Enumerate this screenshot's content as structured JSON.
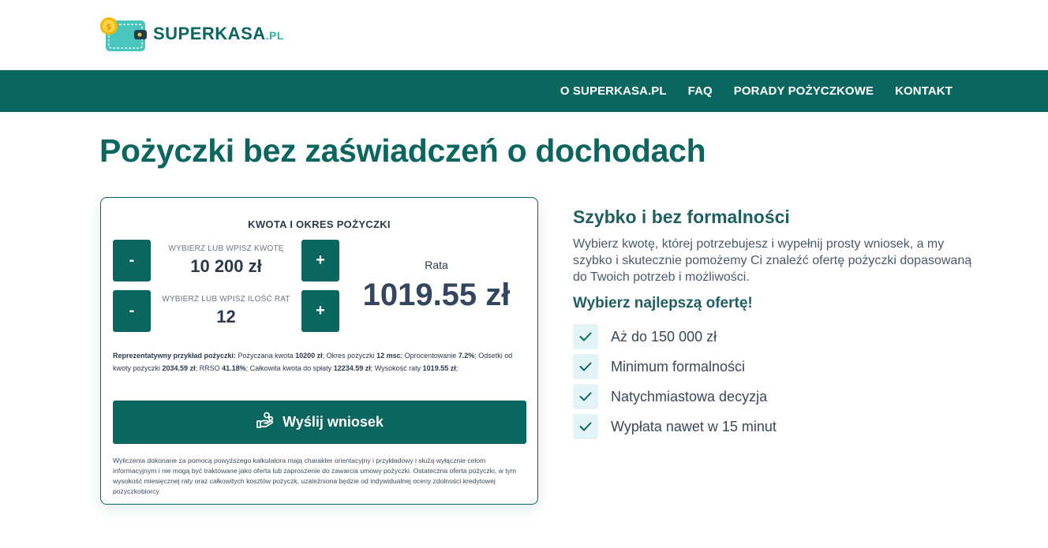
{
  "logo": {
    "name": "SUPERKASA",
    "tld": ".PL"
  },
  "nav": [
    {
      "label": "O SUPERKASA.PL"
    },
    {
      "label": "FAQ"
    },
    {
      "label": "PORADY POŻYCZKOWE"
    },
    {
      "label": "KONTAKT"
    }
  ],
  "page_title": "Pożyczki bez zaświadczeń o dochodach",
  "calculator": {
    "heading": "KWOTA I OKRES POŻYCZKI",
    "amount": {
      "label": "WYBIERZ LUB WPISZ KWOTĘ",
      "value": "10 200 zł",
      "minus": "-",
      "plus": "+"
    },
    "term": {
      "label": "WYBIERZ LUB WPISZ ILOŚĆ RAT",
      "value": "12",
      "minus": "-",
      "plus": "+"
    },
    "rate": {
      "label": "Rata",
      "value": "1019.55 zł"
    },
    "representative": {
      "title": "Reprezentatywny przykład pożyczki:",
      "t1": " Pożyczana kwota ",
      "v1": "10200 zł",
      "t2": "; Okres pożyczki ",
      "v2": "12 msc",
      "t3": "; Oprocentowanie ",
      "v3": "7.2%",
      "t4": "; Odsetki od kwoty pożyczki ",
      "v4": "2034.59 zł",
      "t5": "; RRSO ",
      "v5": "41.18%",
      "t6": "; Całkowita kwota do spłaty ",
      "v6": "12234.59 zł",
      "t7": "; Wysokość raty ",
      "v7": "1019.55 zł",
      "t8": ";"
    },
    "submit_label": "Wyślij wniosek",
    "disclaimer": "Wyliczenia dokonane za pomocą powyższego kalkulatora mają charakter orientacyjny i przykładowy i służą wyłącznie celom informacyjnym i nie mogą być traktowane jako oferta lub zaproszenie do zawarcia umowy pożyczki. Ostateczna oferta pożyczki, w tym wysokość miesięcznej raty oraz całkowitych kosztów pożyczk, uzależniona będzie od indywidualnej oceny zdolności kredytowej pożyczkobiorcy"
  },
  "info": {
    "title": "Szybko i bez formalności",
    "text": "Wybierz kwotę, której potrzebujesz i wypełnij prosty wniosek, a my szybko i skutecznie pomożemy Ci znaleźć ofertę pożyczki dopasowaną do Twoich potrzeb i możliwości.",
    "subtitle": "Wybierz najlepszą ofertę!",
    "features": [
      {
        "label": "Aż do 150 000 zł"
      },
      {
        "label": "Minimum formalności"
      },
      {
        "label": "Natychmiastowa decyzja"
      },
      {
        "label": "Wypłata nawet w 15 minut"
      }
    ]
  },
  "colors": {
    "brand": "#0c6660",
    "accent": "#2ab3a8",
    "check_bg": "#e3f3f6"
  }
}
